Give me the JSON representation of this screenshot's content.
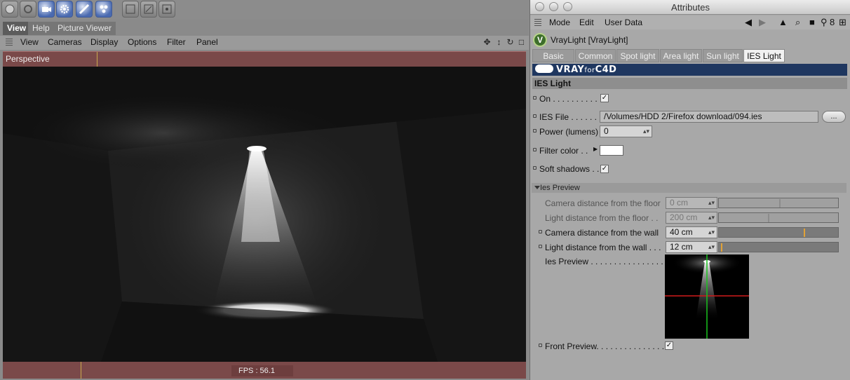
{
  "left": {
    "toolbar_icons": [
      "sphere-icon",
      "gear-icon",
      "camera-icon",
      "gear-icon",
      "deformer-icon",
      "molecule-icon",
      "render-icon",
      "render-edit-icon",
      "settings-icon"
    ],
    "tabs": [
      "View",
      "Help",
      "Picture Viewer"
    ],
    "view_menu": [
      "View",
      "Cameras",
      "Display",
      "Options",
      "Filter",
      "Panel"
    ],
    "viewport_title": "Perspective",
    "fps": "FPS : 56.1"
  },
  "attributes": {
    "window_title": "Attributes",
    "menu": [
      "Mode",
      "Edit",
      "User Data"
    ],
    "object_name": "VrayLight [VrayLight]",
    "tabs": [
      "Basic",
      "Common",
      "Spot light",
      "Area light",
      "Sun light",
      "IES Light"
    ],
    "active_tab": "IES Light",
    "brand_logo_text": "VRAYforC4D",
    "section_title": "IES Light",
    "on_label": "On . . . . . . . . . . .",
    "ies_file_label": "IES File . . . . . . .",
    "ies_file_value": "/Volumes/HDD 2/Firefox download/094.ies",
    "browse_label": "...",
    "power_label": "Power (lumens)",
    "power_value": "0",
    "filter_color_label": "Filter color . .",
    "filter_color_value": "#ffffff",
    "soft_shadows_label": "Soft shadows . .",
    "preview_section_title": "Ies Preview",
    "cam_floor_label": "Camera distance from the floor",
    "cam_floor_value": "0 cm",
    "light_floor_label": "Light distance from the floor . .",
    "light_floor_value": "200 cm",
    "cam_wall_label": "Camera distance from the wall",
    "cam_wall_value": "40 cm",
    "light_wall_label": "Light distance from the wall . . .",
    "light_wall_value": "12 cm",
    "preview_label": "Ies Preview . . . . . . . . . . . . . . . . .",
    "front_preview_label": "Front Preview. . . . . . . . . . . . . . . .",
    "colors": {
      "viewport_header": "#7a4949",
      "vray_bar": "#1f3760",
      "slider_knob": "#e1a237",
      "crosshair_h": "#d11a1a",
      "crosshair_v": "#19c21e"
    }
  }
}
